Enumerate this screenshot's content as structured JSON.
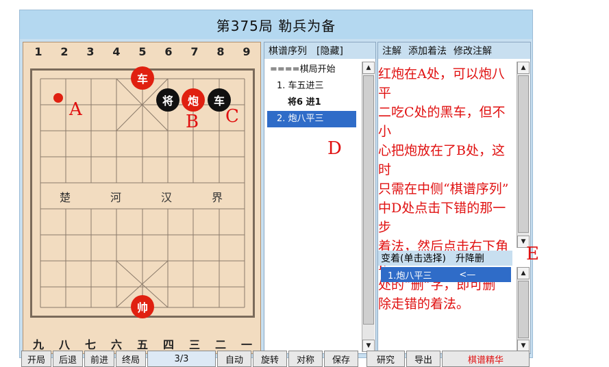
{
  "title": "第375局 勒兵为备",
  "board": {
    "top_files": [
      "1",
      "2",
      "3",
      "4",
      "5",
      "6",
      "7",
      "8",
      "9"
    ],
    "bottom_files": [
      "九",
      "八",
      "七",
      "六",
      "五",
      "四",
      "三",
      "二",
      "一"
    ],
    "river": [
      "楚",
      "河",
      "汉",
      "界"
    ],
    "pieces": {
      "red_chariot": "车",
      "black_general": "将",
      "red_cannon": "炮",
      "black_chariot": "车",
      "red_marshal": "帅"
    },
    "labels": {
      "a": "A",
      "b": "B",
      "c": "C"
    }
  },
  "move_panel": {
    "header": "棋谱序列",
    "hide_label": "[隐藏]",
    "moves": [
      "====棋局开始",
      "1. 车五进三",
      "将6 进1",
      "2. 炮八平三"
    ],
    "label_d": "D"
  },
  "comment_panel": {
    "tabs": [
      "注解",
      "添加着法",
      "修改注解"
    ],
    "comment_lines": [
      "红炮在A处，可以炮八平",
      "二吃C处的黑车，但不小",
      "心把炮放在了B处，这时",
      "只需在中侧“棋谱序列”",
      "中D处点击下错的那一步",
      "着法，然后点击右下角E",
      "处的“删”字，即可删",
      "除走错的着法。"
    ],
    "variation_header": "变着(单击选择)",
    "variation_controls": "升降删",
    "variation_item": "1.炮八平三",
    "variation_arrow": "<—",
    "label_e": "E"
  },
  "toolbar": {
    "buttons": [
      "开局",
      "后退",
      "前进",
      "终局",
      "3/3",
      "自动",
      "旋转",
      "对称",
      "保存",
      "研究",
      "导出",
      "棋谱精华"
    ]
  },
  "colors": {
    "red": "#e02010",
    "black": "#111111",
    "annotation": "#e01010",
    "selection": "#2f6cc8"
  }
}
